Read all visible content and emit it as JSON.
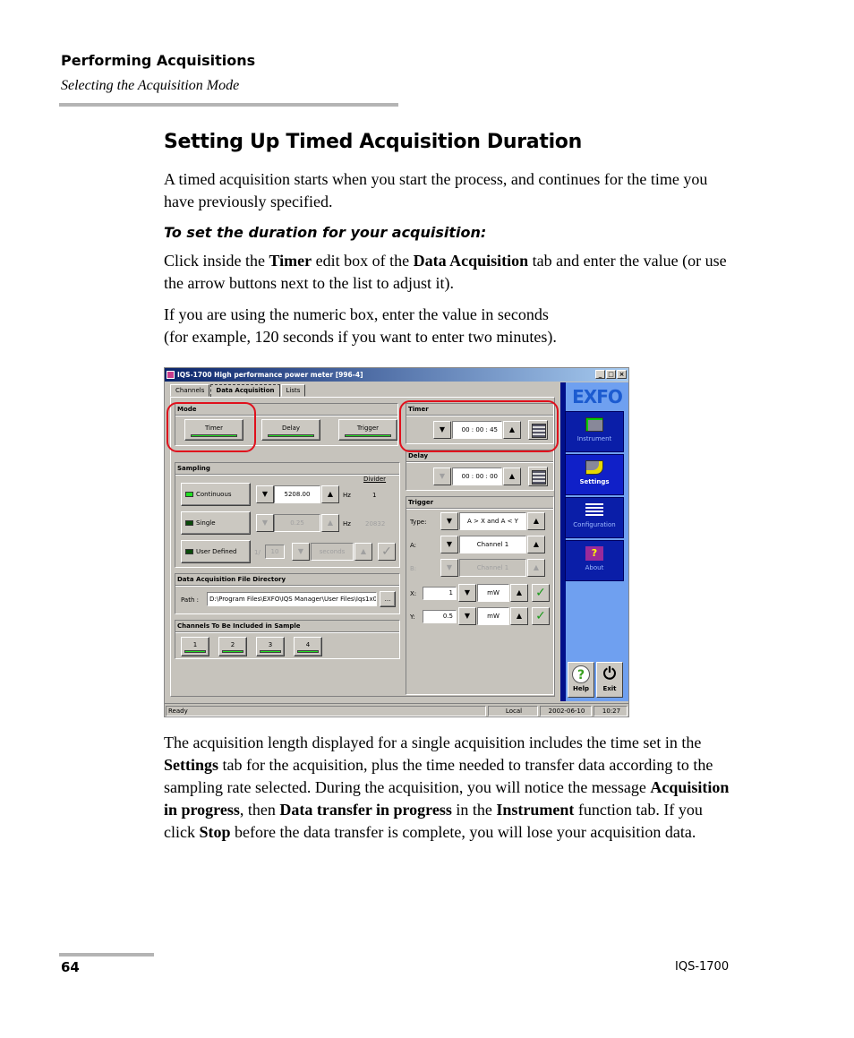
{
  "header": {
    "chapter": "Performing Acquisitions",
    "section": "Selecting the Acquisition Mode"
  },
  "heading": "Setting Up Timed Acquisition Duration",
  "intro": "A timed acquisition starts when you start the process, and continues for the time you have previously specified.",
  "procedure_title": "To set the duration for your acquisition:",
  "step1": {
    "t1": "Click inside the ",
    "b1": "Timer",
    "t2": " edit box of the ",
    "b2": "Data Acquisition",
    "t3": " tab and enter the value (or use the arrow buttons next to the list to adjust it)."
  },
  "step2": {
    "line1": "If you are using the numeric box, enter the value in seconds",
    "line2": "(for example, 120 seconds if you want to enter two minutes)."
  },
  "after": {
    "t1": "The acquisition length displayed for a single acquisition includes the time set in the ",
    "b1": "Settings",
    "t2": " tab for the acquisition, plus the time needed to transfer data according to the sampling rate selected. During the acquisition, you will notice the message ",
    "b2": "Acquisition in progress",
    "t3": ", then ",
    "b3": "Data transfer in progress",
    "t4": " in the ",
    "b4": "Instrument",
    "t5": " function tab. If you click ",
    "b5": "Stop",
    "t6": " before the data transfer is complete, you will lose your acquisition data."
  },
  "footer": {
    "page_number": "64",
    "product": "IQS-1700"
  },
  "screenshot": {
    "window_title": "IQS-1700 High performance power meter [996-4]",
    "window_buttons": [
      "_",
      "□",
      "×"
    ],
    "tabs": [
      {
        "label": "Channels",
        "active": false
      },
      {
        "label": "Data Acquisition",
        "active": true
      },
      {
        "label": "Lists",
        "active": false
      }
    ],
    "mode": {
      "title": "Mode",
      "buttons": [
        "Timer",
        "Delay",
        "Trigger"
      ]
    },
    "timer": {
      "title": "Timer",
      "value": "00 : 00 : 45"
    },
    "delay": {
      "title": "Delay",
      "value": "00 : 00 : 00"
    },
    "sampling": {
      "title": "Sampling",
      "divider_label": "Divider",
      "continuous": {
        "label": "Continuous",
        "value": "5208.00",
        "unit": "Hz",
        "divider": "1"
      },
      "single": {
        "label": "Single",
        "value": "0.25",
        "unit": "Hz",
        "divider": "20832"
      },
      "user_defined": {
        "label": "User Defined",
        "prefix": "1/",
        "value": "10",
        "unit": "seconds"
      }
    },
    "file_dir": {
      "title": "Data Acquisition File Directory",
      "path_label": "Path :",
      "path_value": "D:\\Program Files\\EXFO\\IQS Manager\\User Files\\Iqs1x00\\",
      "browse_label": "..."
    },
    "channels": {
      "title": "Channels To Be Included in Sample",
      "buttons": [
        "1",
        "2",
        "3",
        "4"
      ]
    },
    "trigger": {
      "title": "Trigger",
      "type_label": "Type:",
      "type_value": "A > X and A < Y",
      "a_label": "A:",
      "a_value": "Channel 1",
      "b_label": "B:",
      "b_value": "Channel 1",
      "x_label": "X:",
      "x_value": "1",
      "x_unit": "mW",
      "y_label": "Y:",
      "y_value": "0.5",
      "y_unit": "mW"
    },
    "sidebar": {
      "logo": "EXFO",
      "items": [
        {
          "label": "Instrument",
          "active": false
        },
        {
          "label": "Settings",
          "active": true
        },
        {
          "label": "Configuration",
          "active": false
        },
        {
          "label": "About",
          "active": false
        }
      ],
      "help_label": "Help",
      "exit_label": "Exit"
    },
    "statusbar": {
      "status": "Ready",
      "mode": "Local",
      "date": "2002-06-10",
      "time": "10:27"
    },
    "colors": {
      "led_on": "#22dd22",
      "highlight_ring": "#e0101c",
      "sidebar_bg": "#6fa0f0",
      "nav_button": "#0a1ea8"
    }
  }
}
